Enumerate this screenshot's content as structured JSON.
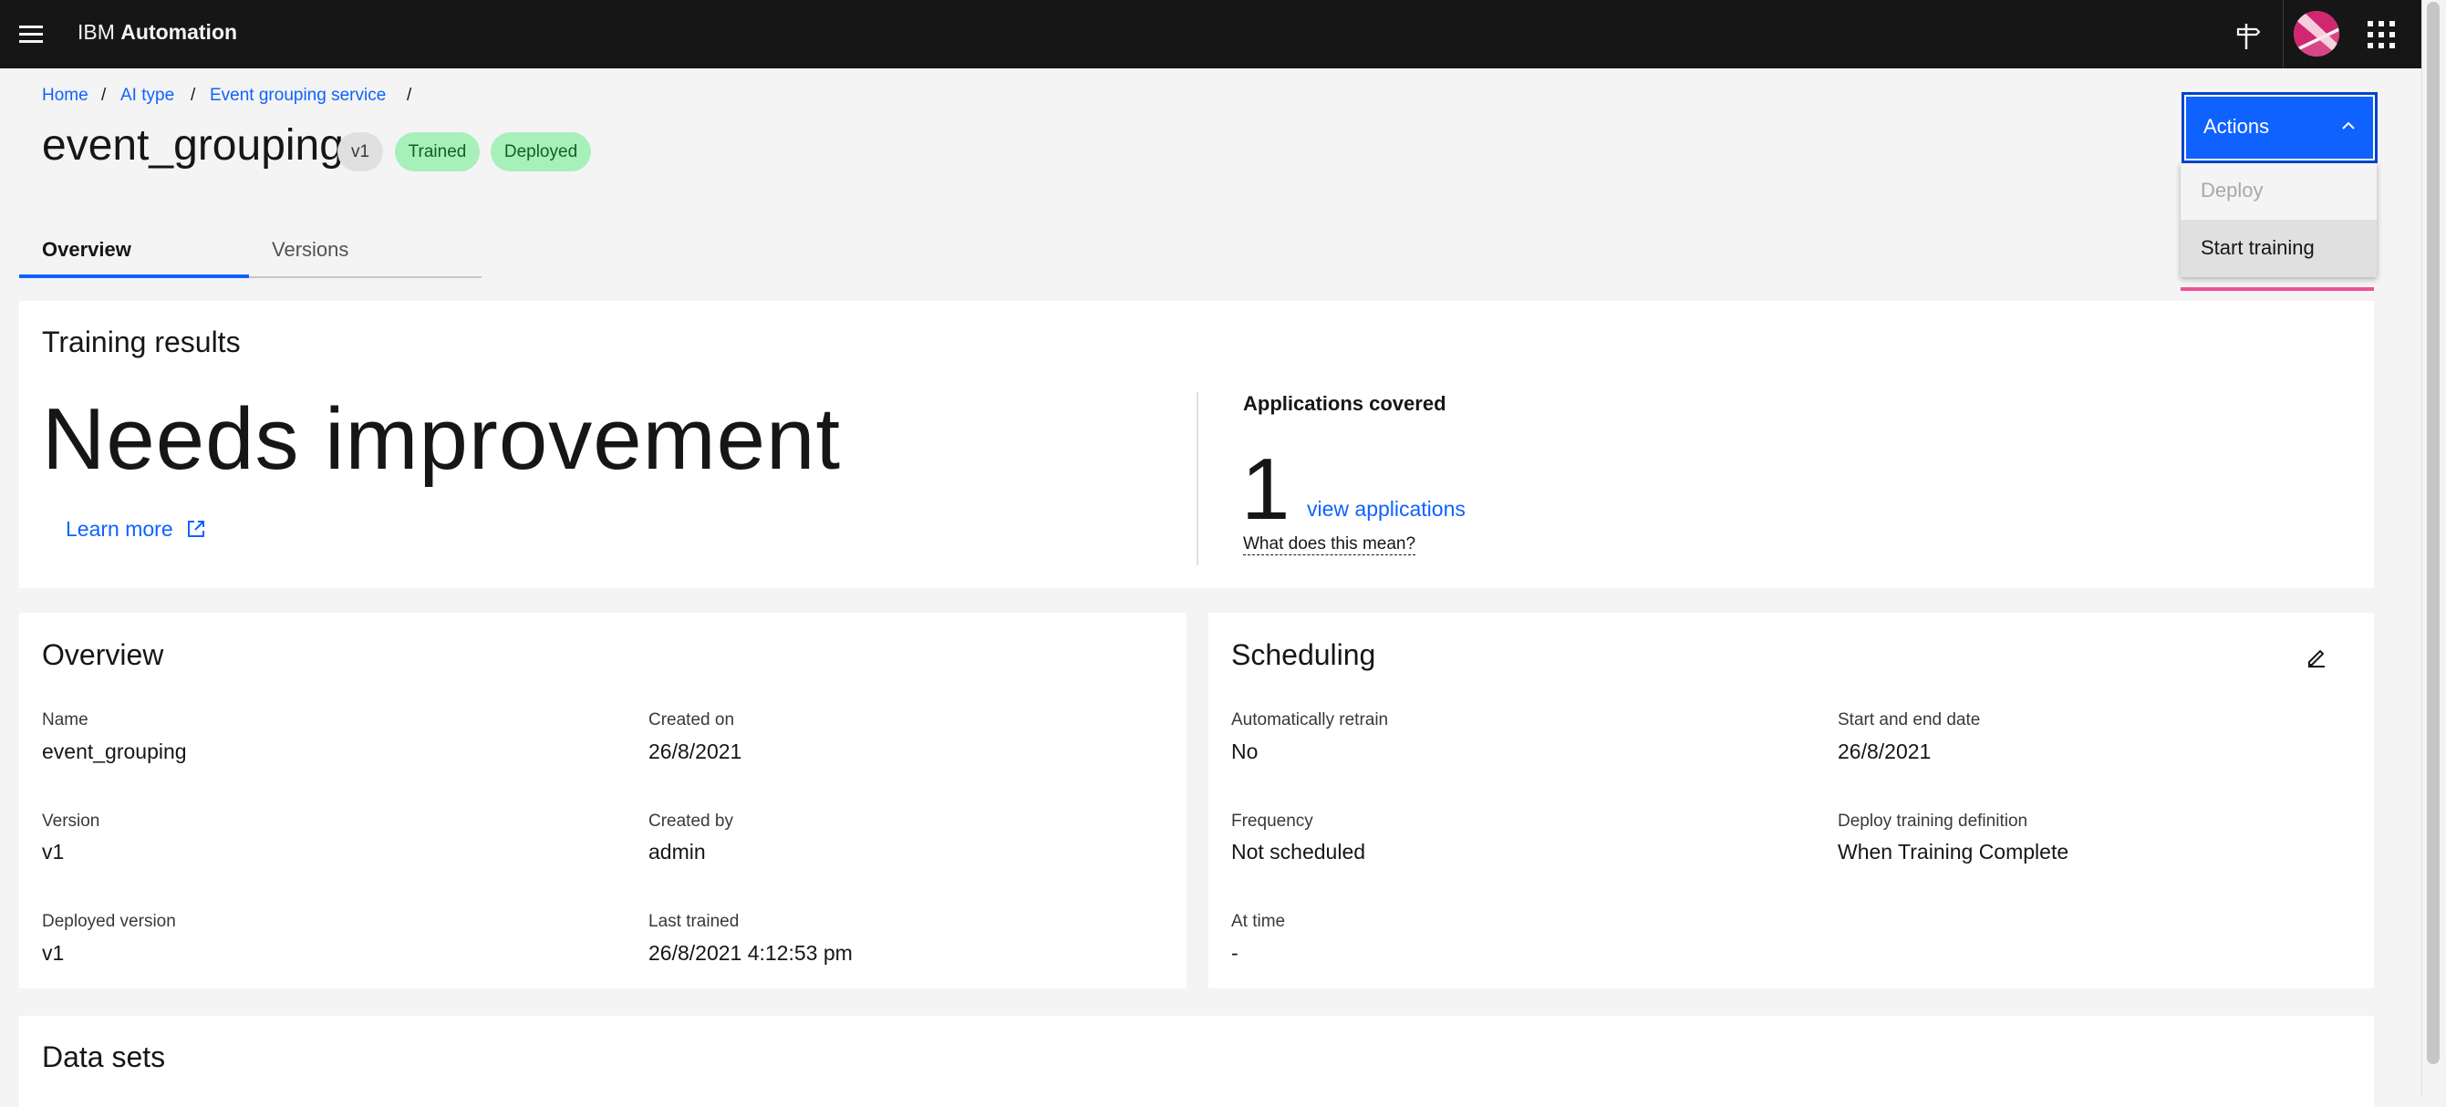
{
  "header": {
    "brand_prefix": "IBM",
    "brand_name": "Automation",
    "icons": [
      "menu-icon",
      "signpost-icon",
      "avatar",
      "app-switcher-icon"
    ]
  },
  "breadcrumb": [
    "Home",
    "AI type",
    "Event grouping service"
  ],
  "breadcrumb_separator": "/",
  "page": {
    "title": "event_grouping",
    "tags": {
      "version": "v1",
      "trained": "Trained",
      "deployed": "Deployed"
    }
  },
  "tabs": [
    {
      "label": "Overview",
      "selected": true
    },
    {
      "label": "Versions",
      "selected": false
    }
  ],
  "actions": {
    "label": "Actions",
    "menu": [
      {
        "label": "Deploy",
        "disabled": true
      },
      {
        "label": "Start training",
        "disabled": false
      }
    ]
  },
  "training_results": {
    "title": "Training results",
    "rating": "Needs improvement",
    "learn_more": "Learn more",
    "applications_covered_label": "Applications covered",
    "applications_count": "1",
    "view_applications": "view applications",
    "what_does_this_mean": "What does this mean?"
  },
  "overview": {
    "title": "Overview",
    "fields": {
      "name": {
        "label": "Name",
        "value": "event_grouping"
      },
      "created_on": {
        "label": "Created on",
        "value": "26/8/2021"
      },
      "version": {
        "label": "Version",
        "value": "v1"
      },
      "created_by": {
        "label": "Created by",
        "value": "admin"
      },
      "deployed_version": {
        "label": "Deployed version",
        "value": "v1"
      },
      "last_trained": {
        "label": "Last trained",
        "value": "26/8/2021 4:12:53 pm"
      }
    }
  },
  "scheduling": {
    "title": "Scheduling",
    "fields": {
      "auto_retrain": {
        "label": "Automatically retrain",
        "value": "No"
      },
      "start_end": {
        "label": "Start and end date",
        "value": "26/8/2021"
      },
      "frequency": {
        "label": "Frequency",
        "value": "Not scheduled"
      },
      "deploy_def": {
        "label": "Deploy training definition",
        "value": "When Training Complete"
      },
      "at_time": {
        "label": "At time",
        "value": "-"
      }
    }
  },
  "data_sets": {
    "title": "Data sets"
  },
  "colors": {
    "accent": "#0f62fe",
    "header_bg": "#161616",
    "success_tag": "#a7f0ba",
    "highlight": "#ee5396"
  }
}
